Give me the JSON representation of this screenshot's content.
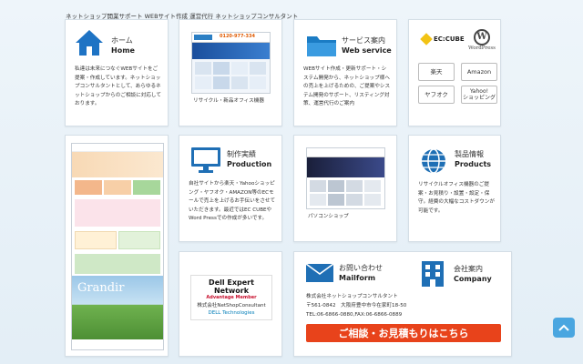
{
  "header": {
    "tagline": "ネットショップ開業サポート WEBサイト作成 運営代行 ネットショップコンサルタント"
  },
  "home": {
    "title_jp": "ホーム",
    "title_en": "Home",
    "body": "私達は未来につなぐWEBサイトをご提案・作成しています。ネットショップコンサルタントとして、あらゆるネットショップからのご相談に対応しております。"
  },
  "recycle": {
    "caption": "リサイクル・新品オフィス機器",
    "shot_phone": "0120-977-334"
  },
  "services": {
    "title_jp": "サービス案内",
    "title_en": "Web service",
    "body": "WEBサイト作成・更新サポート・システム開発から、ネットショップ様への売上を上げるための、ご提案やシステム開発のサポート、リスティング対策、運営代行のご案内"
  },
  "platforms": {
    "eccube": "EC:CUBE",
    "wordpress": "WordPress",
    "buttons": [
      "楽天",
      "Amazon",
      "ヤフオク",
      "Yahoo!\nショッピング"
    ]
  },
  "production": {
    "title_jp": "制作実績",
    "title_en": "Production",
    "body": "自社サイトから楽天・Yahooショッピング・ヤフオク・AMAZON等のECモールで売上を上げるお手伝いをさせていただきます。最近ではEC CUBEやWord Pressでの作成が多いです。"
  },
  "pcshop": {
    "caption": "パソコンショップ"
  },
  "products": {
    "title_jp": "製品情報",
    "title_en": "Products",
    "body": "リサイクルオフィス機器のご提案・お見積り・設置・設定・保守。経費の大幅なコストダウンが可能です。"
  },
  "left_column": {
    "shot_word": "Grandir"
  },
  "dell": {
    "line1": "Dell Expert Network",
    "line2": "Advantage Member",
    "line3": "株式会社NetShopConsultant",
    "line4": "DELL Technologies"
  },
  "contact": {
    "title_jp": "お問い合わせ",
    "title_en": "Mailform",
    "company_jp": "会社案内",
    "company_en": "Company",
    "name": "株式会社ネットショップコンサルタント",
    "address": "〒561-0842　大阪府豊中市今在家町18-50",
    "tel": "TEL:06-6866-0880,FAX:06-6866-0889",
    "cta": "ご相談・お見積もりはこちら"
  },
  "colors": {
    "accent": "#1f6fb5",
    "cta": "#e8431b",
    "brand": "#2b7fc4"
  }
}
